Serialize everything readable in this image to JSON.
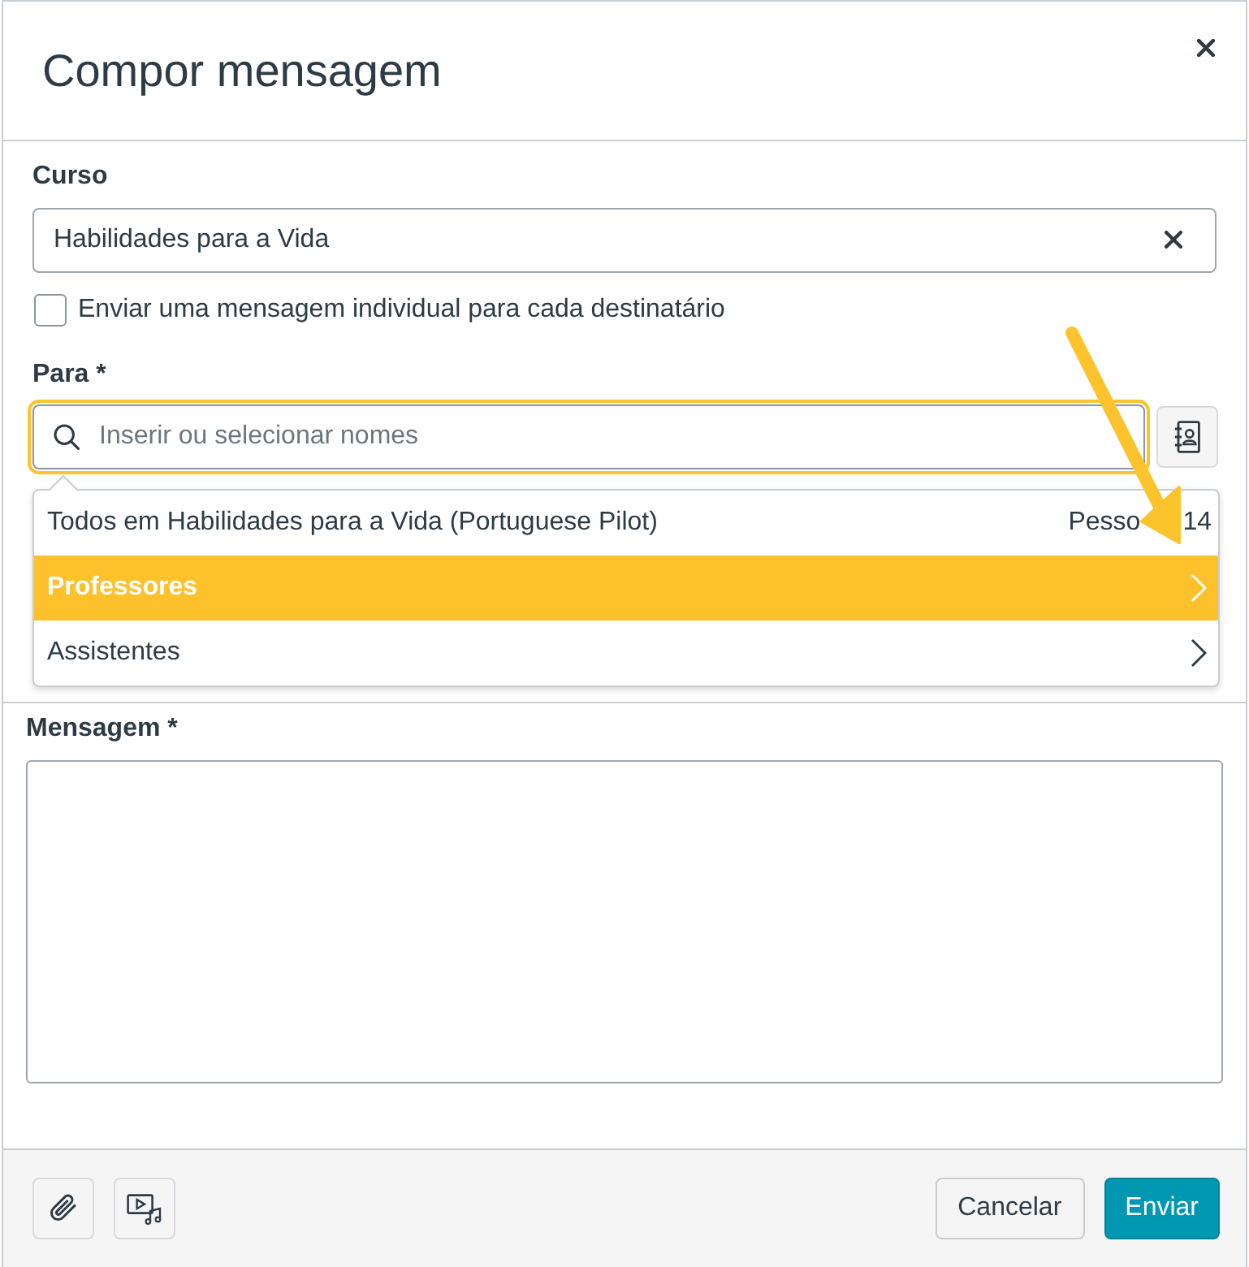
{
  "dialog": {
    "title": "Compor mensagem"
  },
  "course": {
    "label": "Curso",
    "value": "Habilidades para a Vida"
  },
  "individual_message": {
    "label": "Enviar uma mensagem individual para cada destinatário",
    "checked": false
  },
  "to": {
    "label": "Para *",
    "placeholder": "Inserir ou selecionar nomes",
    "focused": true
  },
  "recipient_menu": {
    "items": [
      {
        "kind": "group",
        "label": "Todos em Habilidades para a Vida (Portuguese Pilot)",
        "people_label": "Pesso",
        "count": "14",
        "selected": false
      },
      {
        "kind": "submenu",
        "label": "Professores",
        "selected": true
      },
      {
        "kind": "submenu",
        "label": "Assistentes",
        "selected": false
      }
    ]
  },
  "message": {
    "label": "Mensagem *"
  },
  "footer": {
    "buttons": [
      {
        "kind": "cancel",
        "label": "Cancelar"
      },
      {
        "kind": "send",
        "label": "Enviar"
      }
    ]
  }
}
